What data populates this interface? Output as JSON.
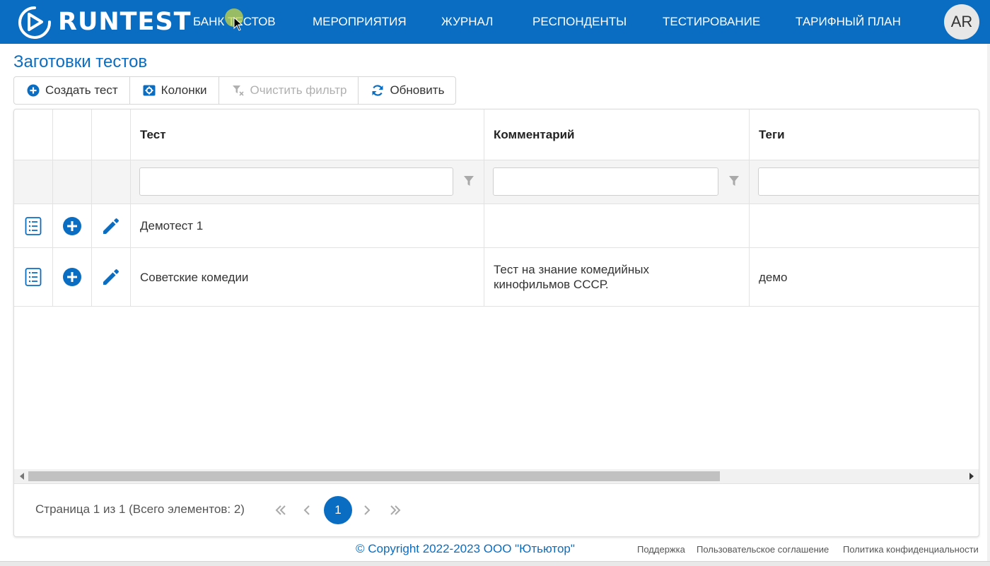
{
  "colors": {
    "brand": "#0a6dc2",
    "header_bg": "#0a6dc2",
    "icon_blue": "#0a6dc2",
    "disabled": "#b0b0b0"
  },
  "header": {
    "logo_text": "RUNTEST",
    "nav": [
      "Банк тестов",
      "Мероприятия",
      "Журнал",
      "Респонденты",
      "Тестирование",
      "Тарифный план"
    ],
    "avatar_initials": "AR"
  },
  "page": {
    "title": "Заготовки тестов"
  },
  "toolbar": {
    "create_label": "Создать тест",
    "columns_label": "Колонки",
    "clear_filter_label": "Очистить фильтр",
    "refresh_label": "Обновить"
  },
  "table": {
    "columns": [
      "Тест",
      "Комментарий",
      "Теги"
    ],
    "rows": [
      {
        "test": "Демотест 1",
        "comment": "",
        "tags": ""
      },
      {
        "test": "Советские комедии",
        "comment": "Тест на знание комедийных кинофильмов СССР.",
        "tags": "демо"
      }
    ],
    "row_icons": [
      "list-icon",
      "plus-circle-icon",
      "pencil-icon"
    ]
  },
  "pager": {
    "info": "Страница 1 из 1 (Всего элементов: 2)",
    "current_page": "1"
  },
  "footer": {
    "copyright": "© Copyright 2022-2023 ООО \"Ютьютор\"",
    "links": [
      "Поддержка",
      "Пользовательское соглашение",
      "Политика конфиденциальности"
    ]
  }
}
